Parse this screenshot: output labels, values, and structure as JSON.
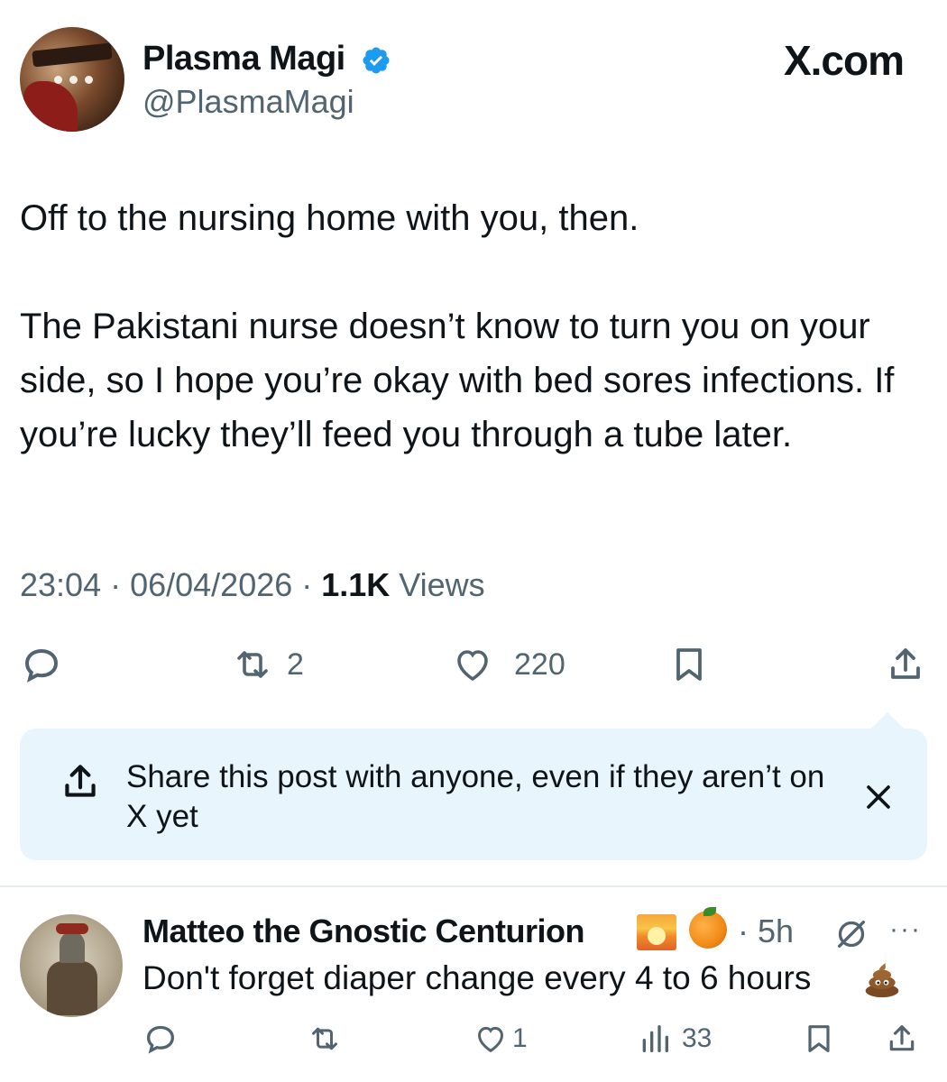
{
  "post": {
    "display_name": "Plasma Magi",
    "handle": "@PlasmaMagi",
    "brand": "X.com",
    "paragraph_1": "Off to the nursing home with you, then.",
    "paragraph_2": "The Pakistani nurse doesn’t know to turn you on your side, so I hope you’re okay with bed sores infections. If you’re lucky they’ll feed you through a tube later.",
    "timestamp": "23:04 · 06/04/2026 · ",
    "views_count": "1.1K",
    "views_label": " Views",
    "actions": {
      "reposts": "2",
      "likes": "220"
    },
    "icons": [
      "reply-icon",
      "repost-icon",
      "heart-icon",
      "bookmark-icon",
      "share-icon",
      "verified-badge-icon"
    ],
    "accent_color": "#1d9bf0"
  },
  "share_banner": {
    "text": "Share this post with anyone, even if they aren’t on X yet",
    "background": "#e8f5fd"
  },
  "reply": {
    "display_name": "Matteo the Gnostic Centurion",
    "time": "· 5h",
    "more": "···",
    "text": "Don't forget diaper change every 4 to 6 hours",
    "emojis": [
      "sunrise-emoji",
      "orange-emoji",
      "poop-emoji"
    ],
    "actions": {
      "likes": "1",
      "views": "33"
    }
  }
}
